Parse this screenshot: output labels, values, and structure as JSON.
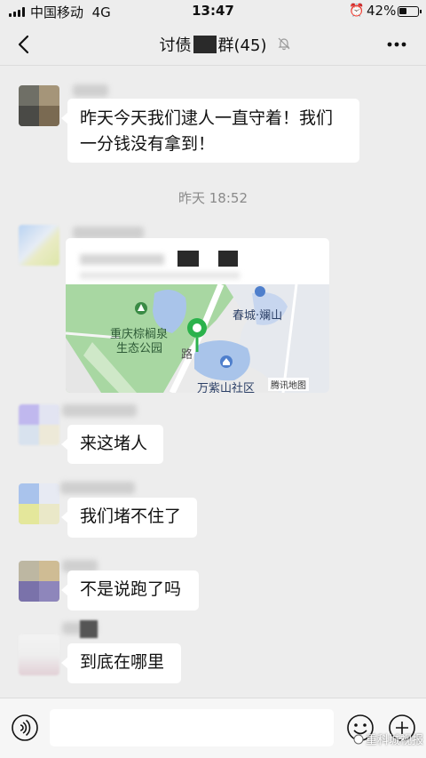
{
  "status_bar": {
    "carrier": "中国移动",
    "network": "4G",
    "time": "13:47",
    "battery_percent": "42%",
    "battery_level": 0.42,
    "icons": [
      "signal-icon",
      "alarm-icon",
      "battery-icon"
    ]
  },
  "nav": {
    "title_prefix": "讨债",
    "title_suffix": "群",
    "member_count": "(45)",
    "icons": [
      "back-icon",
      "mute-bell-icon",
      "more-icon"
    ]
  },
  "messages": [
    {
      "type": "text",
      "text": "昨天今天我们逮人一直守着！我们一分钱没有拿到！"
    },
    {
      "type": "timestamp",
      "text": "昨天 18:52"
    },
    {
      "type": "location",
      "map_labels": [
        "春城·斓山",
        "重庆棕榈泉",
        "生态公园",
        "万紫山社区"
      ],
      "map_road": "路",
      "map_badge": "腾讯地图"
    },
    {
      "type": "text",
      "text": "来这堵人"
    },
    {
      "type": "text",
      "text": "我们堵不住了"
    },
    {
      "type": "text",
      "text": "不是说跑了吗"
    },
    {
      "type": "text",
      "text": "到底在哪里"
    }
  ],
  "input_bar": {
    "icons": [
      "voice-icon",
      "emoji-icon",
      "plus-icon"
    ]
  },
  "watermark": "重科城视报",
  "colors": {
    "background": "#ededed",
    "bubble": "#ffffff",
    "map_green": "#a8d7a2",
    "map_water": "#a9c4ea",
    "pin_green": "#2bb24c"
  }
}
